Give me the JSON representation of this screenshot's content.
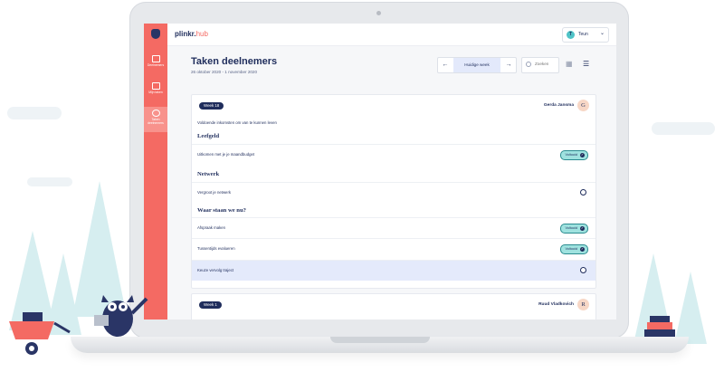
{
  "app": {
    "brand": "plinkr.",
    "brand_suffix": "hub",
    "user_initial": "T",
    "user_name": "Teun"
  },
  "sidebar": {
    "items": [
      {
        "label": "Deelnemers",
        "icon": "users-icon"
      },
      {
        "label": "Mijn taken",
        "icon": "tasks-icon"
      },
      {
        "label": "Taken deelnemers",
        "icon": "target-icon"
      }
    ]
  },
  "header": {
    "title": "Taken deelnemers",
    "subtitle": "26 oktober 2020 - 1 november 2020"
  },
  "week_nav": {
    "prev": "←",
    "current": "Huidige week",
    "next": "→"
  },
  "search": {
    "placeholder": "Zoeken"
  },
  "views": {
    "grid": "▦",
    "list": "☰"
  },
  "cards": [
    {
      "week": "Week 18",
      "participant": "Gerda Jansma",
      "initial": "G",
      "goal": "Voldoende inkomsten om van te kunnen leven",
      "sections": [
        {
          "title": "Leefgeld",
          "tasks": [
            {
              "label": "Uitkomen met je je maandbudget",
              "status": "Voltooid",
              "done": true
            }
          ]
        },
        {
          "title": "Netwerk",
          "tasks": [
            {
              "label": "Vergroot je netwerk",
              "done": false
            }
          ]
        },
        {
          "title": "Waar staan we nu?",
          "tasks": [
            {
              "label": "Afspraak maken",
              "status": "Voltooid",
              "done": true
            },
            {
              "label": "Tussentijds evalueren",
              "status": "Voltooid",
              "done": true
            },
            {
              "label": "Keuze vervolg traject",
              "done": false
            }
          ]
        }
      ]
    },
    {
      "week": "Week 1",
      "participant": "Ruud Vladkovich",
      "initial": "R"
    }
  ],
  "colors": {
    "brand": "#f46a63",
    "navy": "#1f2d5c",
    "done": "#9fe2df",
    "highlight": "#e4eafb"
  }
}
